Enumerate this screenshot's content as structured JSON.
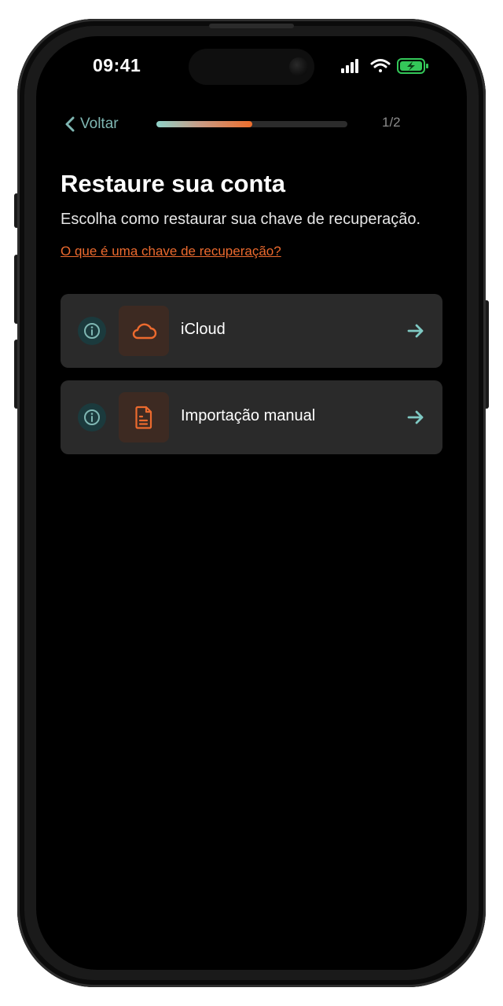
{
  "status_bar": {
    "time": "09:41"
  },
  "header": {
    "back_label": "Voltar",
    "progress": 0.5,
    "step_counter": "1/2"
  },
  "main": {
    "title": "Restaure sua conta",
    "subtitle": "Escolha como restaurar sua chave de recuperação.",
    "help_link": "O que é uma chave de recuperação?",
    "options": [
      {
        "label": "iCloud",
        "icon": "cloud-icon"
      },
      {
        "label": "Importação manual",
        "icon": "document-icon"
      }
    ]
  },
  "colors": {
    "background": "#000000",
    "card": "#2a2a2a",
    "accent_orange": "#ec6a2e",
    "accent_teal": "#7fb7b3",
    "battery_green": "#34c759"
  }
}
